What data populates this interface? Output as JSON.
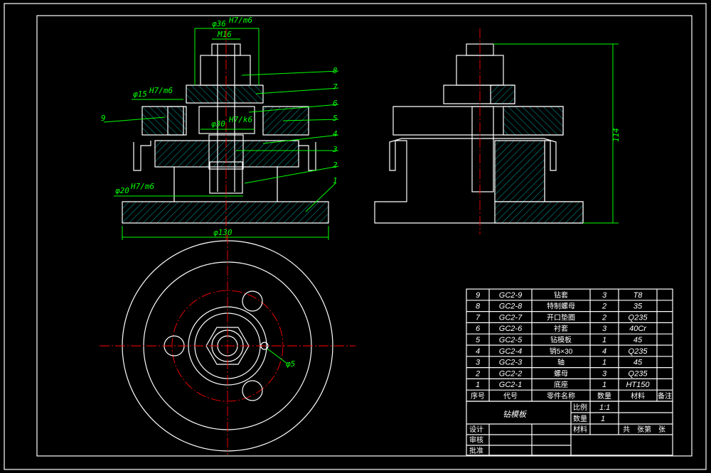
{
  "dimensions": {
    "d36": "φ36",
    "d36_fit": "H7/m6",
    "m16": "M16",
    "d15": "φ15",
    "d15_fit": "H7/m6",
    "d30": "φ30",
    "d30_fit": "H7/k6",
    "d20": "φ20",
    "d20_fit": "H7/m6",
    "d130": "φ130",
    "h114": "114",
    "d5": "φ5"
  },
  "balloons": [
    "9",
    "8",
    "7",
    "6",
    "5",
    "4",
    "3",
    "2",
    "1"
  ],
  "bom": {
    "rows": [
      [
        "9",
        "GC2-9",
        "钻套",
        "3",
        "T8",
        ""
      ],
      [
        "8",
        "GC2-8",
        "特制螺母",
        "2",
        "35",
        ""
      ],
      [
        "7",
        "GC2-7",
        "开口垫圈",
        "2",
        "Q235",
        ""
      ],
      [
        "6",
        "GC2-6",
        "衬套",
        "3",
        "40Cr",
        ""
      ],
      [
        "5",
        "GC2-5",
        "钻模板",
        "1",
        "45",
        ""
      ],
      [
        "4",
        "GC2-4",
        "销5×30",
        "4",
        "Q235",
        ""
      ],
      [
        "3",
        "GC2-3",
        "轴",
        "1",
        "45",
        ""
      ],
      [
        "2",
        "GC2-2",
        "螺母",
        "3",
        "Q235",
        ""
      ],
      [
        "1",
        "GC2-1",
        "底座",
        "1",
        "HT150",
        ""
      ]
    ],
    "header": [
      "序号",
      "代号",
      "零件名称",
      "数量",
      "材料",
      "备注"
    ]
  },
  "title_block": {
    "name": "钻模板",
    "scale_label": "比例",
    "scale_value": "1:1",
    "qty_label": "数量",
    "qty_value": "1",
    "material_label": "材料",
    "sheets": "共　张第　张",
    "design": "设计",
    "check": "审核",
    "approve": "批准"
  },
  "colors": {
    "background": "#000000",
    "outline": "#ffffff",
    "dimension": "#00ff00",
    "centerline": "#ff0000",
    "hatch": "#00ffff"
  }
}
